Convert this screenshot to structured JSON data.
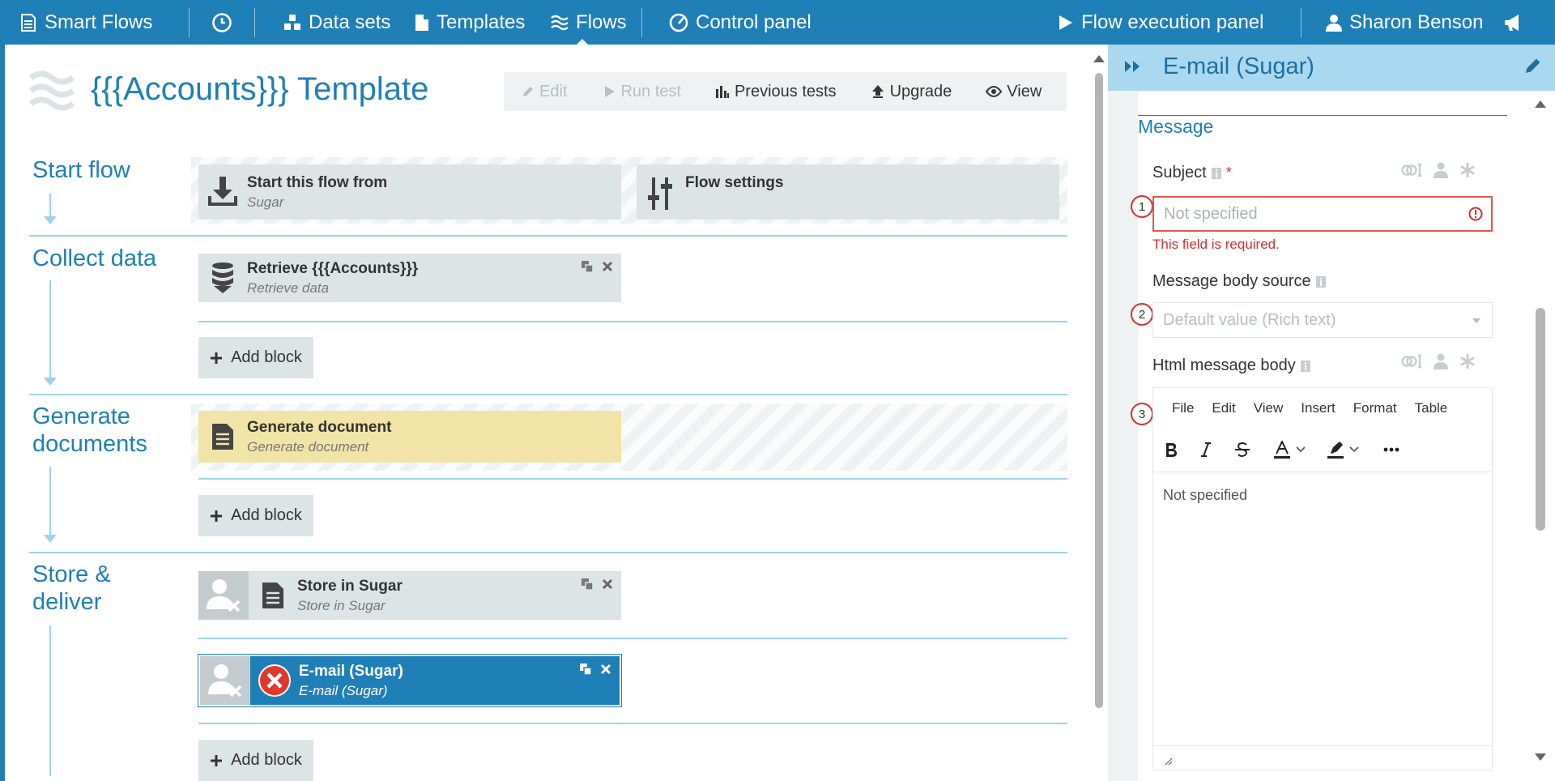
{
  "nav": {
    "brand": "Smart Flows",
    "items": [
      "Data sets",
      "Templates",
      "Flows",
      "Control panel"
    ],
    "execution_panel": "Flow execution panel",
    "user": "Sharon Benson"
  },
  "page": {
    "title": "{{{Accounts}}} Template",
    "toolbar": {
      "edit": "Edit",
      "run_test": "Run test",
      "previous_tests": "Previous tests",
      "upgrade": "Upgrade",
      "view": "View"
    }
  },
  "sections": {
    "start": {
      "title": "Start flow",
      "block1_title": "Start this flow from",
      "block1_sub": "Sugar",
      "block2_title": "Flow settings"
    },
    "collect": {
      "title": "Collect data",
      "block_title": "Retrieve {{{Accounts}}}",
      "block_sub": "Retrieve data",
      "add": "Add block"
    },
    "generate": {
      "title_line1": "Generate",
      "title_line2": "documents",
      "block_title": "Generate document",
      "block_sub": "Generate document",
      "add": "Add block"
    },
    "store": {
      "title_line1": "Store &",
      "title_line2": "deliver",
      "block1_title": "Store in Sugar",
      "block1_sub": "Store in Sugar",
      "block2_title": "E-mail (Sugar)",
      "block2_sub": "E-mail (Sugar)",
      "add": "Add block"
    }
  },
  "panel": {
    "title": "E-mail (Sugar)",
    "section": "Message",
    "subject": {
      "label": "Subject",
      "required_mark": "*",
      "placeholder": "Not specified",
      "error": "This field is required.",
      "badge": "1"
    },
    "body_source": {
      "label": "Message body source",
      "value": "Default value (Rich text)",
      "badge": "2"
    },
    "html_body": {
      "label": "Html message body",
      "badge": "3",
      "menu": [
        "File",
        "Edit",
        "View",
        "Insert",
        "Format",
        "Table"
      ],
      "content": "Not specified"
    }
  },
  "colors": {
    "brand": "#1f7fb7",
    "panel_header": "#a9d8ef",
    "error": "#d0312d",
    "block": "#dde4e6",
    "highlight_block": "#f2e4a6"
  }
}
